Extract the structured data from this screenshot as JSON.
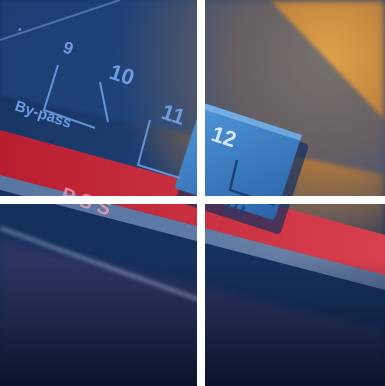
{
  "photo": {
    "labels": {
      "n9": "9",
      "n10": "10",
      "n11": "11",
      "n12": "12",
      "bypass": "By-pass",
      "pss": "P S S"
    },
    "colors": {
      "panel_dark": "#0f2a52",
      "panel_mid": "#1f4a8a",
      "panel_light": "#5c8fcf",
      "label_blue": "#6d9ce0",
      "button_blue": "#3a7fc4",
      "strip_red": "#c8283a",
      "background_orange": "#c9873a",
      "gap_white": "#ffffff"
    }
  }
}
